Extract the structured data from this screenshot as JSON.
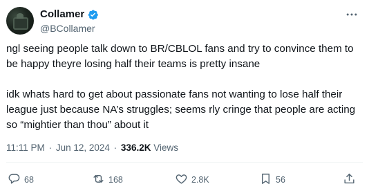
{
  "author": {
    "display_name": "Collamer",
    "handle": "@BCollamer",
    "verified": true
  },
  "tweet": {
    "paragraphs": [
      "ngl seeing people talk down to BR/CBLOL fans and try to convince them to be happy theyre losing half their teams is pretty insane",
      "idk whats hard to get about passionate fans not wanting to lose half their league just because NA’s struggles; seems rly cringe that people are acting so “mightier than thou” about it"
    ],
    "time": "11:11 PM",
    "date": "Jun 12, 2024",
    "separator": "·",
    "views_count": "336.2K",
    "views_label": "Views"
  },
  "actions": {
    "replies": "68",
    "reposts": "168",
    "likes": "2.8K",
    "bookmarks": "56"
  },
  "icons": {
    "verified": "verified-badge-icon",
    "more": "more-horizontal-icon",
    "reply": "reply-icon",
    "repost": "repost-icon",
    "like": "heart-icon",
    "bookmark": "bookmark-icon",
    "share": "share-icon"
  },
  "colors": {
    "text": "#0f1419",
    "secondary": "#536471",
    "verified": "#1d9bf0",
    "divider": "#eff3f4"
  }
}
